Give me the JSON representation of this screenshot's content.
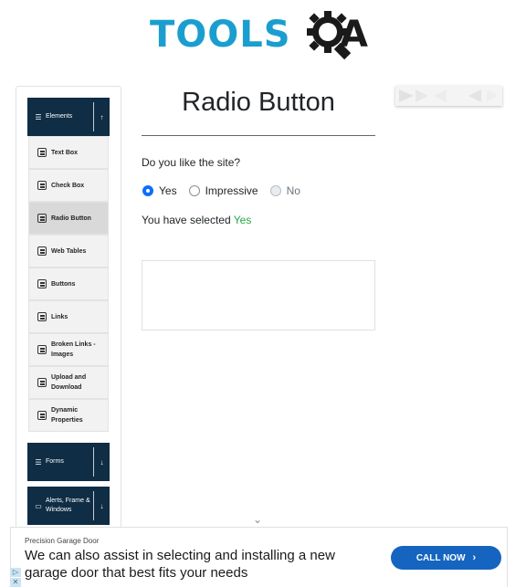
{
  "logo": {
    "text": "TOOLS",
    "suffix": "A"
  },
  "sidebar": {
    "groups": [
      {
        "label": "Elements",
        "icon": "list-icon",
        "toggle": "↑"
      },
      {
        "label": "Forms",
        "icon": "list-icon",
        "toggle": "↓"
      },
      {
        "label": "Alerts, Frame & Windows",
        "icon": "window-icon",
        "toggle": "↓"
      }
    ],
    "items": [
      {
        "label": "Text Box"
      },
      {
        "label": "Check Box"
      },
      {
        "label": "Radio Button",
        "active": true
      },
      {
        "label": "Web Tables"
      },
      {
        "label": "Buttons"
      },
      {
        "label": "Links"
      },
      {
        "label": "Broken Links - Images"
      },
      {
        "label": "Upload and Download"
      },
      {
        "label": "Dynamic Properties"
      }
    ]
  },
  "main": {
    "title": "Radio Button",
    "question": "Do you like the site?",
    "options": [
      {
        "label": "Yes",
        "state": "checked"
      },
      {
        "label": "Impressive",
        "state": "unchecked"
      },
      {
        "label": "No",
        "state": "disabled"
      }
    ],
    "result_prefix": "You have selected",
    "result_value": "Yes",
    "scroll_hint": "⌄"
  },
  "banner": {
    "sponsor": "Precision Garage Door",
    "text": "We can also assist in selecting and installing a new garage door that best fits your needs",
    "cta": "CALL NOW",
    "cta_icon": "chevron-right-icon"
  },
  "colors": {
    "sidebar_header": "#0f2d44",
    "accent": "#0d6efd",
    "success": "#28a745",
    "logo_blue": "#1a9ecf",
    "cta_blue": "#1565c0"
  }
}
